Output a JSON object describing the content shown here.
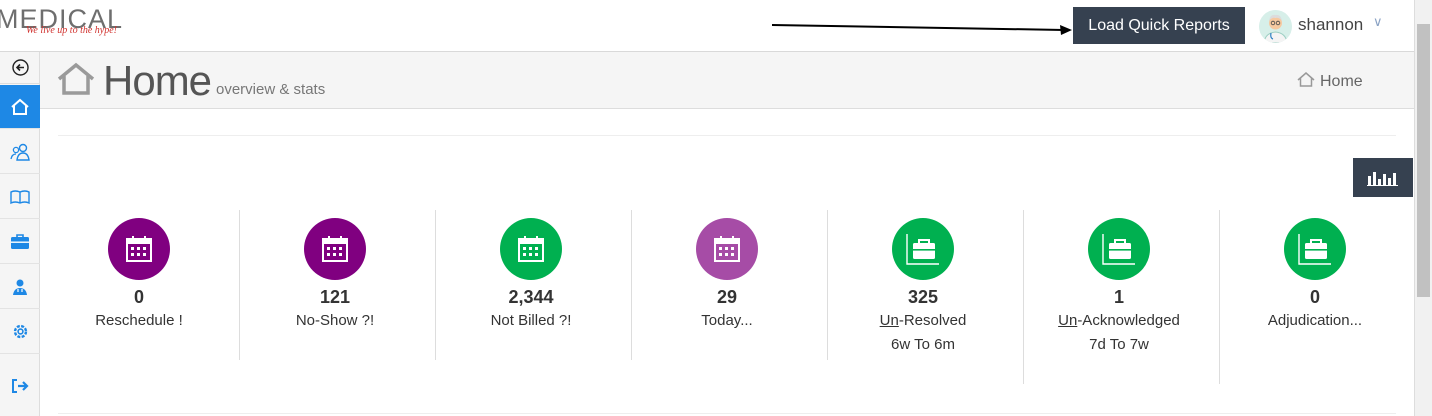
{
  "logo": {
    "main": "MEDICAL",
    "tagline": "We live up to the hype!"
  },
  "header": {
    "quick_reports_label": "Load Quick Reports",
    "user_name": "shannon",
    "chevron": "∨"
  },
  "page": {
    "title": "Home",
    "subtitle": "overview & stats",
    "breadcrumb": "Home"
  },
  "colors": {
    "purple_dark": "#800080",
    "purple_light": "#a64ca6",
    "green": "#00b050",
    "nav_dark": "#364150",
    "active_blue": "#1e88e5"
  },
  "stats": [
    {
      "value": "0",
      "label": "Reschedule !",
      "color": "purple_dark",
      "icon": "calendar-icon"
    },
    {
      "value": "121",
      "label": "No-Show ?!",
      "color": "purple_dark",
      "icon": "calendar-icon"
    },
    {
      "value": "2,344",
      "label": "Not Billed ?!",
      "color": "green",
      "icon": "calendar-icon"
    },
    {
      "value": "29",
      "label": "Today...",
      "color": "purple_light",
      "icon": "calendar-icon"
    },
    {
      "value": "325",
      "label_prefix": "Un",
      "label_rest": "-Resolved",
      "sub": "6w To 6m",
      "color": "green",
      "icon": "briefcase-icon"
    },
    {
      "value": "1",
      "label_prefix": "Un",
      "label_rest": "-Acknowledged",
      "sub": "7d To 7w",
      "color": "green",
      "icon": "briefcase-icon"
    },
    {
      "value": "0",
      "label": "Adjudication...",
      "color": "green",
      "icon": "briefcase-icon"
    }
  ],
  "sidebar_icons": [
    "back-arrow-icon",
    "home-icon",
    "users-icon",
    "book-icon",
    "briefcase-icon",
    "user-doctor-icon",
    "gear-icon",
    "logout-icon"
  ]
}
